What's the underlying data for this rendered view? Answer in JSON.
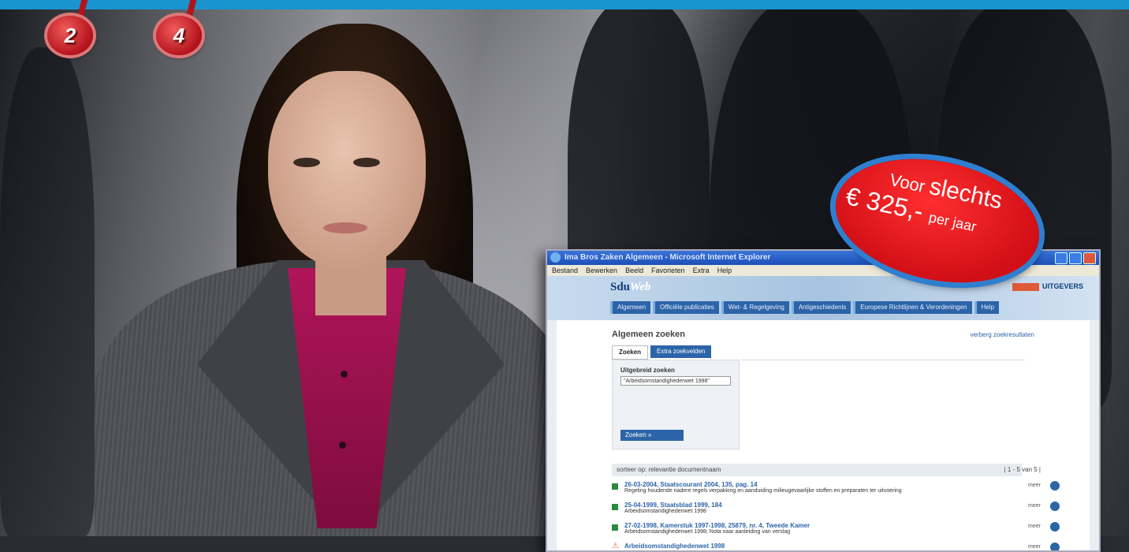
{
  "header": {
    "numbers": [
      "2",
      "4"
    ]
  },
  "price_badge": {
    "voor": "Voor",
    "slechts": "slechts",
    "amount": "€ 325,-",
    "per_jaar": "per jaar"
  },
  "browser": {
    "title": "Ima Bros Zaken Algemeen - Microsoft Internet Explorer",
    "menu": [
      "Bestand",
      "Bewerken",
      "Beeld",
      "Favorieten",
      "Extra",
      "Help"
    ],
    "logo_a": "Sdu",
    "logo_b": "Web",
    "brand": "UITGEVERS",
    "nav_tabs": [
      "Algemeen",
      "Officiële publicaties",
      "Wet- & Regelgeving",
      "Antigeschiedenis",
      "Europese Richtlijnen & Verordeningen",
      "Help"
    ],
    "page_title": "Algemeen zoeken",
    "top_link": "verberg zoekresultaten",
    "subtabs": [
      "Zoeken",
      "Extra zoekvelden"
    ],
    "search_label": "Uitgebreid zoeken",
    "search_value": "\"Arbeidsomstandighedenwet 1998\"",
    "search_button": "Zoeken »",
    "sort_text": "sorteer op: relevantie documentnaam",
    "pager": "| 1 - 5 van 5 |",
    "results": [
      {
        "title": "26-03-2004, Staatscourant 2004, 135, pag. 14",
        "desc": "Regeling houdende nadere regels verpakking en aanduiding milieugevaarlijke stoffen en preparaten ter uitvoering"
      },
      {
        "title": "25-04-1999, Staatsblad 1999, 184",
        "desc": "Arbeidsomstandighedenwet 1998"
      },
      {
        "title": "27-02-1998, Kamerstuk 1997-1998, 25879, nr. 4, Tweede Kamer",
        "desc": "Arbeidsomstandighedenwet 1998; Nota naar aanleiding van verslag"
      },
      {
        "title": "Arbeidsomstandighedenwet 1998",
        "desc": ""
      }
    ],
    "more_label": "meer"
  }
}
